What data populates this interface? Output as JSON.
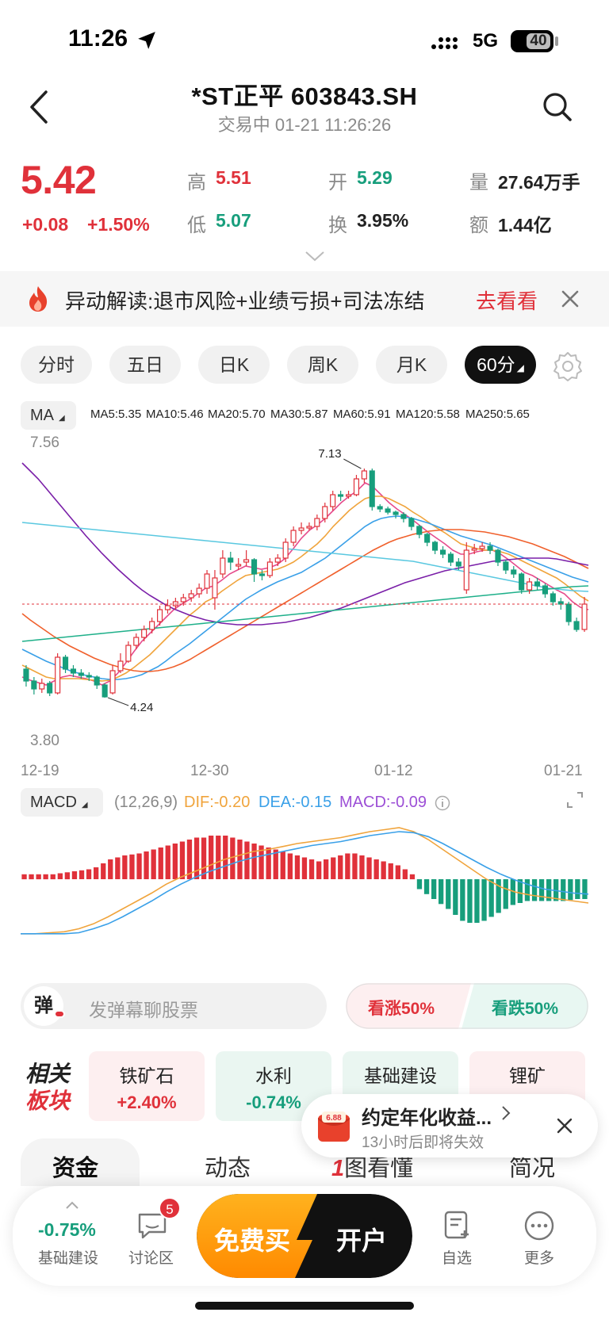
{
  "status": {
    "time": "11:26",
    "network": "5G",
    "battery": "40"
  },
  "header": {
    "title": "*ST正平 603843.SH",
    "subtitle": "交易中 01-21 11:26:26"
  },
  "quote": {
    "price": "5.42",
    "change": "+0.08",
    "change_pct": "+1.50%",
    "high_label": "高",
    "high": "5.51",
    "low_label": "低",
    "low": "5.07",
    "open_label": "开",
    "open": "5.29",
    "turnover_label": "换",
    "turnover": "3.95%",
    "volume_label": "量",
    "volume": "27.64万手",
    "amount_label": "额",
    "amount": "1.44亿"
  },
  "alert": {
    "text": "异动解读:退市风险+业绩亏损+司法冻结",
    "link": "去看看"
  },
  "tabs": [
    "分时",
    "五日",
    "日K",
    "周K",
    "月K",
    "60分"
  ],
  "active_tab": "60分",
  "ma": {
    "button": "MA",
    "items": [
      {
        "label": "MA5:5.35",
        "color": "#e64b8c"
      },
      {
        "label": "MA10:5.46",
        "color": "#f0a43c"
      },
      {
        "label": "MA20:5.70",
        "color": "#3aa0e8"
      },
      {
        "label": "MA30:5.87",
        "color": "#f0602c"
      },
      {
        "label": "MA60:5.91",
        "color": "#7a1fa8"
      },
      {
        "label": "MA120:5.58",
        "color": "#5ac8e0"
      },
      {
        "label": "MA250:5.65",
        "color": "#1fb08a"
      }
    ]
  },
  "chart_data": {
    "type": "candlestick",
    "y_top_label": "7.56",
    "y_bottom_label": "3.80",
    "ylim": [
      3.8,
      7.56
    ],
    "high_annotation": "7.13",
    "low_annotation": "4.24",
    "x_tick_labels": [
      "12-19",
      "12-30",
      "01-12",
      "01-21"
    ],
    "current_price": 5.42,
    "candles": [
      [
        4.6,
        4.45,
        4.65,
        4.38
      ],
      [
        4.45,
        4.35,
        4.5,
        4.28
      ],
      [
        4.35,
        4.42,
        4.48,
        4.3
      ],
      [
        4.42,
        4.3,
        4.45,
        4.26
      ],
      [
        4.3,
        4.75,
        4.8,
        4.28
      ],
      [
        4.75,
        4.6,
        4.78,
        4.55
      ],
      [
        4.6,
        4.55,
        4.65,
        4.5
      ],
      [
        4.55,
        4.52,
        4.6,
        4.48
      ],
      [
        4.52,
        4.5,
        4.56,
        4.45
      ],
      [
        4.5,
        4.4,
        4.52,
        4.35
      ],
      [
        4.4,
        4.25,
        4.42,
        4.24
      ],
      [
        4.3,
        4.58,
        4.65,
        4.28
      ],
      [
        4.58,
        4.7,
        4.8,
        4.55
      ],
      [
        4.7,
        4.9,
        4.95,
        4.68
      ],
      [
        4.9,
        5.0,
        5.05,
        4.85
      ],
      [
        5.0,
        5.1,
        5.15,
        4.95
      ],
      [
        5.1,
        5.2,
        5.25,
        5.05
      ],
      [
        5.2,
        5.35,
        5.4,
        5.15
      ],
      [
        5.35,
        5.4,
        5.48,
        5.3
      ],
      [
        5.4,
        5.45,
        5.5,
        5.35
      ],
      [
        5.45,
        5.5,
        5.55,
        5.4
      ],
      [
        5.5,
        5.55,
        5.6,
        5.45
      ],
      [
        5.55,
        5.62,
        5.68,
        5.5
      ],
      [
        5.62,
        5.8,
        5.85,
        5.55
      ],
      [
        5.5,
        5.75,
        5.85,
        5.35
      ],
      [
        5.8,
        6.0,
        6.1,
        5.75
      ],
      [
        6.0,
        5.95,
        6.08,
        5.85
      ],
      [
        5.9,
        5.92,
        6.0,
        5.85
      ],
      [
        5.95,
        5.98,
        6.1,
        5.9
      ],
      [
        5.98,
        5.8,
        6.0,
        5.7
      ],
      [
        5.8,
        5.78,
        5.85,
        5.72
      ],
      [
        5.78,
        5.95,
        6.0,
        5.75
      ],
      [
        5.95,
        6.0,
        6.05,
        5.9
      ],
      [
        6.0,
        6.2,
        6.25,
        5.95
      ],
      [
        6.2,
        6.35,
        6.4,
        6.15
      ],
      [
        6.35,
        6.38,
        6.45,
        6.3
      ],
      [
        6.38,
        6.4,
        6.45,
        6.35
      ],
      [
        6.4,
        6.5,
        6.55,
        6.35
      ],
      [
        6.5,
        6.65,
        6.7,
        6.45
      ],
      [
        6.65,
        6.8,
        6.85,
        6.6
      ],
      [
        6.8,
        6.78,
        6.85,
        6.72
      ],
      [
        6.78,
        6.8,
        6.85,
        6.75
      ],
      [
        6.8,
        7.0,
        7.05,
        6.78
      ],
      [
        7.0,
        7.1,
        7.13,
        6.95
      ],
      [
        7.1,
        6.65,
        7.13,
        6.6
      ],
      [
        6.65,
        6.62,
        6.68,
        6.58
      ],
      [
        6.62,
        6.58,
        6.65,
        6.55
      ],
      [
        6.58,
        6.55,
        6.6,
        6.5
      ],
      [
        6.55,
        6.5,
        6.58,
        6.45
      ],
      [
        6.5,
        6.4,
        6.52,
        6.35
      ],
      [
        6.4,
        6.3,
        6.42,
        6.25
      ],
      [
        6.3,
        6.2,
        6.32,
        6.15
      ],
      [
        6.2,
        6.1,
        6.22,
        6.05
      ],
      [
        6.1,
        6.05,
        6.15,
        6.0
      ],
      [
        6.05,
        5.95,
        6.08,
        5.9
      ],
      [
        5.95,
        5.9,
        6.0,
        5.85
      ],
      [
        5.6,
        6.1,
        6.2,
        5.55
      ],
      [
        6.1,
        6.12,
        6.18,
        6.05
      ],
      [
        6.12,
        6.15,
        6.2,
        6.08
      ],
      [
        6.15,
        6.1,
        6.2,
        6.05
      ],
      [
        6.1,
        5.95,
        6.12,
        5.9
      ],
      [
        5.95,
        5.85,
        5.98,
        5.8
      ],
      [
        5.85,
        5.8,
        5.9,
        5.75
      ],
      [
        5.8,
        5.6,
        5.82,
        5.55
      ],
      [
        5.6,
        5.7,
        5.75,
        5.55
      ],
      [
        5.7,
        5.65,
        5.75,
        5.6
      ],
      [
        5.65,
        5.55,
        5.68,
        5.5
      ],
      [
        5.55,
        5.45,
        5.58,
        5.4
      ],
      [
        5.45,
        5.42,
        5.5,
        5.35
      ],
      [
        5.42,
        5.2,
        5.45,
        5.15
      ],
      [
        5.2,
        5.1,
        5.25,
        5.07
      ],
      [
        5.1,
        5.42,
        5.51,
        5.07
      ]
    ],
    "ma_lines": [
      {
        "name": "MA5",
        "color": "#e64b8c",
        "values": [
          4.5,
          4.46,
          4.43,
          4.4,
          4.45,
          4.5,
          4.52,
          4.5,
          4.48,
          4.45,
          4.4,
          4.45,
          4.55,
          4.68,
          4.82,
          4.95,
          5.05,
          5.15,
          5.25,
          5.35,
          5.42,
          5.48,
          5.55,
          5.62,
          5.65,
          5.72,
          5.8,
          5.85,
          5.9,
          5.88,
          5.86,
          5.88,
          5.92,
          6.0,
          6.12,
          6.25,
          6.35,
          6.42,
          6.5,
          6.6,
          6.7,
          6.78,
          6.85,
          6.95,
          6.9,
          6.8,
          6.7,
          6.62,
          6.55,
          6.48,
          6.4,
          6.32,
          6.25,
          6.18,
          6.1,
          6.05,
          6.05,
          6.08,
          6.1,
          6.1,
          6.05,
          5.98,
          5.9,
          5.82,
          5.78,
          5.72,
          5.66,
          5.6,
          5.55,
          5.45,
          5.38,
          5.35
        ]
      },
      {
        "name": "MA10",
        "color": "#f0a43c",
        "values": [
          4.65,
          4.6,
          4.55,
          4.5,
          4.48,
          4.48,
          4.48,
          4.48,
          4.47,
          4.46,
          4.45,
          4.46,
          4.5,
          4.55,
          4.62,
          4.7,
          4.78,
          4.88,
          4.98,
          5.08,
          5.18,
          5.28,
          5.36,
          5.45,
          5.5,
          5.58,
          5.65,
          5.72,
          5.78,
          5.8,
          5.82,
          5.84,
          5.86,
          5.9,
          5.95,
          6.02,
          6.1,
          6.18,
          6.28,
          6.4,
          6.5,
          6.6,
          6.68,
          6.75,
          6.78,
          6.78,
          6.75,
          6.7,
          6.65,
          6.58,
          6.52,
          6.45,
          6.38,
          6.32,
          6.25,
          6.18,
          6.15,
          6.12,
          6.1,
          6.1,
          6.08,
          6.05,
          6.0,
          5.95,
          5.9,
          5.85,
          5.8,
          5.75,
          5.68,
          5.6,
          5.52,
          5.46
        ]
      },
      {
        "name": "MA20",
        "color": "#3aa0e8",
        "values": [
          4.85,
          4.8,
          4.75,
          4.7,
          4.66,
          4.62,
          4.58,
          4.55,
          4.52,
          4.5,
          4.48,
          4.47,
          4.47,
          4.48,
          4.5,
          4.53,
          4.58,
          4.63,
          4.7,
          4.78,
          4.85,
          4.92,
          5.0,
          5.08,
          5.16,
          5.24,
          5.32,
          5.4,
          5.48,
          5.54,
          5.6,
          5.65,
          5.7,
          5.74,
          5.78,
          5.82,
          5.88,
          5.94,
          6.0,
          6.08,
          6.16,
          6.24,
          6.32,
          6.4,
          6.46,
          6.5,
          6.52,
          6.53,
          6.52,
          6.5,
          6.47,
          6.44,
          6.4,
          6.36,
          6.32,
          6.28,
          6.25,
          6.22,
          6.19,
          6.16,
          6.12,
          6.08,
          6.04,
          6.0,
          5.96,
          5.92,
          5.88,
          5.84,
          5.8,
          5.76,
          5.73,
          5.7
        ]
      },
      {
        "name": "MA30",
        "color": "#f0602c",
        "values": [
          5.3,
          5.22,
          5.15,
          5.08,
          5.01,
          4.95,
          4.89,
          4.84,
          4.79,
          4.74,
          4.7,
          4.66,
          4.63,
          4.6,
          4.58,
          4.57,
          4.57,
          4.58,
          4.6,
          4.63,
          4.67,
          4.72,
          4.78,
          4.84,
          4.9,
          4.96,
          5.02,
          5.08,
          5.14,
          5.2,
          5.26,
          5.32,
          5.38,
          5.44,
          5.5,
          5.56,
          5.62,
          5.68,
          5.74,
          5.8,
          5.86,
          5.92,
          5.98,
          6.04,
          6.1,
          6.15,
          6.2,
          6.24,
          6.27,
          6.3,
          6.32,
          6.34,
          6.35,
          6.36,
          6.36,
          6.36,
          6.35,
          6.34,
          6.33,
          6.31,
          6.29,
          6.27,
          6.24,
          6.21,
          6.18,
          6.14,
          6.1,
          6.06,
          6.02,
          5.97,
          5.92,
          5.87
        ]
      },
      {
        "name": "MA60",
        "color": "#7a1fa8",
        "values": [
          7.2,
          7.1,
          7.0,
          6.88,
          6.76,
          6.64,
          6.52,
          6.4,
          6.28,
          6.17,
          6.06,
          5.96,
          5.86,
          5.77,
          5.68,
          5.6,
          5.53,
          5.47,
          5.41,
          5.36,
          5.32,
          5.28,
          5.25,
          5.22,
          5.2,
          5.18,
          5.17,
          5.16,
          5.16,
          5.16,
          5.16,
          5.17,
          5.18,
          5.19,
          5.21,
          5.23,
          5.25,
          5.28,
          5.31,
          5.34,
          5.37,
          5.41,
          5.45,
          5.49,
          5.53,
          5.57,
          5.61,
          5.65,
          5.69,
          5.72,
          5.75,
          5.78,
          5.81,
          5.84,
          5.86,
          5.88,
          5.9,
          5.92,
          5.94,
          5.96,
          5.97,
          5.98,
          5.99,
          6.0,
          6.0,
          6.0,
          6.0,
          5.99,
          5.97,
          5.95,
          5.93,
          5.91
        ]
      },
      {
        "name": "MA120",
        "color": "#5ac8e0",
        "values": [
          6.45,
          6.44,
          6.43,
          6.42,
          6.41,
          6.4,
          6.39,
          6.38,
          6.37,
          6.36,
          6.35,
          6.34,
          6.33,
          6.32,
          6.31,
          6.3,
          6.29,
          6.28,
          6.27,
          6.26,
          6.25,
          6.24,
          6.23,
          6.22,
          6.21,
          6.2,
          6.19,
          6.18,
          6.17,
          6.16,
          6.15,
          6.14,
          6.13,
          6.12,
          6.11,
          6.1,
          6.09,
          6.08,
          6.07,
          6.06,
          6.05,
          6.04,
          6.03,
          6.02,
          6.01,
          6.0,
          5.99,
          5.98,
          5.97,
          5.96,
          5.94,
          5.92,
          5.9,
          5.88,
          5.86,
          5.84,
          5.82,
          5.8,
          5.78,
          5.76,
          5.74,
          5.72,
          5.7,
          5.68,
          5.66,
          5.64,
          5.62,
          5.61,
          5.6,
          5.59,
          5.585,
          5.58
        ]
      },
      {
        "name": "MA250",
        "color": "#1fb08a",
        "values": [
          4.95,
          4.96,
          4.97,
          4.98,
          4.99,
          5.0,
          5.01,
          5.02,
          5.03,
          5.04,
          5.05,
          5.06,
          5.07,
          5.08,
          5.09,
          5.1,
          5.11,
          5.12,
          5.13,
          5.14,
          5.15,
          5.16,
          5.17,
          5.18,
          5.19,
          5.2,
          5.21,
          5.22,
          5.23,
          5.24,
          5.25,
          5.26,
          5.27,
          5.28,
          5.29,
          5.3,
          5.31,
          5.32,
          5.33,
          5.34,
          5.35,
          5.36,
          5.37,
          5.38,
          5.39,
          5.4,
          5.41,
          5.42,
          5.43,
          5.44,
          5.45,
          5.46,
          5.47,
          5.48,
          5.49,
          5.5,
          5.51,
          5.52,
          5.53,
          5.54,
          5.55,
          5.56,
          5.57,
          5.58,
          5.59,
          5.6,
          5.61,
          5.62,
          5.63,
          5.64,
          5.645,
          5.65
        ]
      }
    ]
  },
  "macd": {
    "button": "MACD",
    "params": "(12,26,9)",
    "dif": "DIF:-0.20",
    "dea": "DEA:-0.15",
    "macd": "MACD:-0.09",
    "dif_color": "#f0a43c",
    "dea_color": "#3aa0e8",
    "macd_color": "#9c4fd6",
    "ylim": [
      -0.6,
      0.6
    ],
    "hist": [
      0.05,
      0.05,
      0.05,
      0.05,
      0.05,
      0.06,
      0.07,
      0.08,
      0.09,
      0.1,
      0.12,
      0.16,
      0.2,
      0.22,
      0.24,
      0.25,
      0.26,
      0.28,
      0.3,
      0.32,
      0.34,
      0.36,
      0.38,
      0.4,
      0.42,
      0.42,
      0.44,
      0.44,
      0.44,
      0.42,
      0.4,
      0.38,
      0.36,
      0.34,
      0.32,
      0.3,
      0.28,
      0.26,
      0.24,
      0.22,
      0.2,
      0.18,
      0.2,
      0.22,
      0.24,
      0.26,
      0.26,
      0.24,
      0.22,
      0.2,
      0.18,
      0.16,
      0.14,
      0.1,
      0.05,
      -0.1,
      -0.15,
      -0.2,
      -0.25,
      -0.3,
      -0.36,
      -0.42,
      -0.44,
      -0.44,
      -0.42,
      -0.38,
      -0.34,
      -0.3,
      -0.26,
      -0.24,
      -0.22,
      -0.22,
      -0.22,
      -0.22,
      -0.22,
      -0.22,
      -0.21,
      -0.2,
      -0.2
    ],
    "dif_values": [
      -0.55,
      -0.55,
      -0.54,
      -0.53,
      -0.5,
      -0.45,
      -0.38,
      -0.3,
      -0.22,
      -0.14,
      -0.05,
      0.02,
      0.08,
      0.14,
      0.2,
      0.24,
      0.28,
      0.3,
      0.33,
      0.36,
      0.38,
      0.4,
      0.42,
      0.45,
      0.48,
      0.5,
      0.52,
      0.48,
      0.4,
      0.3,
      0.2,
      0.1,
      0.0,
      -0.08,
      -0.13,
      -0.16,
      -0.18,
      -0.2,
      -0.22,
      -0.24
    ],
    "dea_values": [
      -0.55,
      -0.55,
      -0.55,
      -0.55,
      -0.54,
      -0.5,
      -0.45,
      -0.38,
      -0.3,
      -0.22,
      -0.13,
      -0.05,
      0.02,
      0.08,
      0.13,
      0.18,
      0.22,
      0.25,
      0.28,
      0.31,
      0.34,
      0.36,
      0.38,
      0.41,
      0.44,
      0.46,
      0.48,
      0.47,
      0.43,
      0.36,
      0.28,
      0.2,
      0.12,
      0.05,
      -0.01,
      -0.06,
      -0.1,
      -0.12,
      -0.14,
      -0.15
    ]
  },
  "danmaku": {
    "badge": "弹",
    "placeholder": "发弹幕聊股票"
  },
  "votes": {
    "up": "看涨50%",
    "down": "看跌50%"
  },
  "sectors": {
    "title_line1": "相关",
    "title_line2": "板块",
    "items": [
      {
        "name": "铁矿石",
        "pct": "+2.40%",
        "dir": "up"
      },
      {
        "name": "水利",
        "pct": "-0.74%",
        "dir": "down"
      },
      {
        "name": "基础建设",
        "pct": "",
        "dir": "down"
      },
      {
        "name": "锂矿",
        "pct": "",
        "dir": "up"
      }
    ]
  },
  "popup": {
    "icon_text": "6.88",
    "title": "约定年化收益...",
    "sub": "13小时后即将失效"
  },
  "bottom_tabs": [
    "资金",
    "动态",
    "图看懂",
    "简况"
  ],
  "bottom_bar": {
    "pct": "-0.75%",
    "pct_label": "基础建设",
    "discuss": "讨论区",
    "discuss_badge": "5",
    "cta_free": "免费买",
    "cta_open": "开户",
    "watch": "自选",
    "more": "更多"
  }
}
